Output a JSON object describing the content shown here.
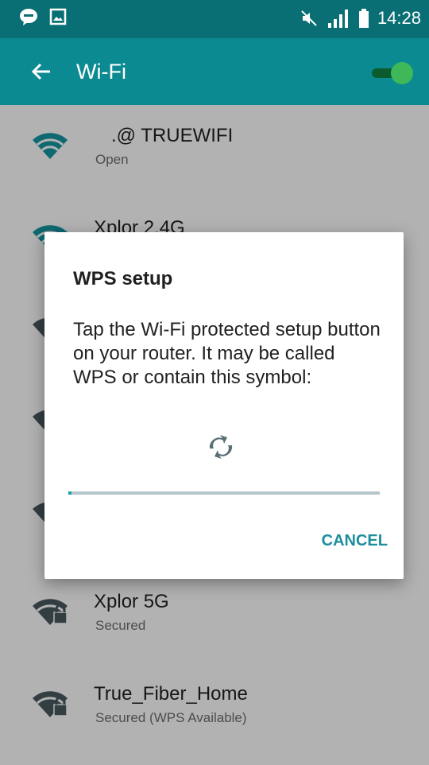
{
  "status_bar": {
    "time": "14:28",
    "icons": [
      "line-app-icon",
      "gallery-icon",
      "mute-icon",
      "signal-icon",
      "battery-icon"
    ]
  },
  "app_bar": {
    "title": "Wi-Fi",
    "wifi_enabled": true
  },
  "networks": [
    {
      "name": ".@ TRUEWIFI",
      "status": "Open",
      "secured": false
    },
    {
      "name": "Xplor 2.4G",
      "status": "",
      "secured": false
    },
    {
      "name": "Xplor 5G",
      "status": "Secured",
      "secured": true
    },
    {
      "name": "True_Fiber_Home",
      "status": "Secured (WPS Available)",
      "secured": true
    }
  ],
  "dialog": {
    "title": "WPS setup",
    "message": "Tap the Wi-Fi protected setup button on your router. It may be called WPS or contain this symbol:",
    "progress": 0.01,
    "cancel_label": "CANCEL"
  },
  "colors": {
    "status_bar": "#0a6f74",
    "app_bar": "#0b8a91",
    "wifi_open_icon": "#1597a3",
    "wifi_secured_icon": "#4a5a60",
    "accent": "#1c8e9d"
  }
}
